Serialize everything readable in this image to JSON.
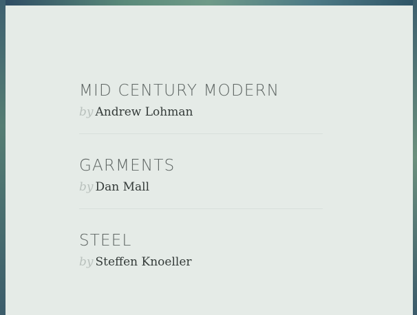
{
  "entries": [
    {
      "title": "MID CENTURY MODERN",
      "by": "by",
      "author": "Andrew Lohman"
    },
    {
      "title": "GARMENTS",
      "by": "by",
      "author": "Dan Mall"
    },
    {
      "title": "STEEL",
      "by": "by",
      "author": "Steffen Knoeller"
    }
  ]
}
